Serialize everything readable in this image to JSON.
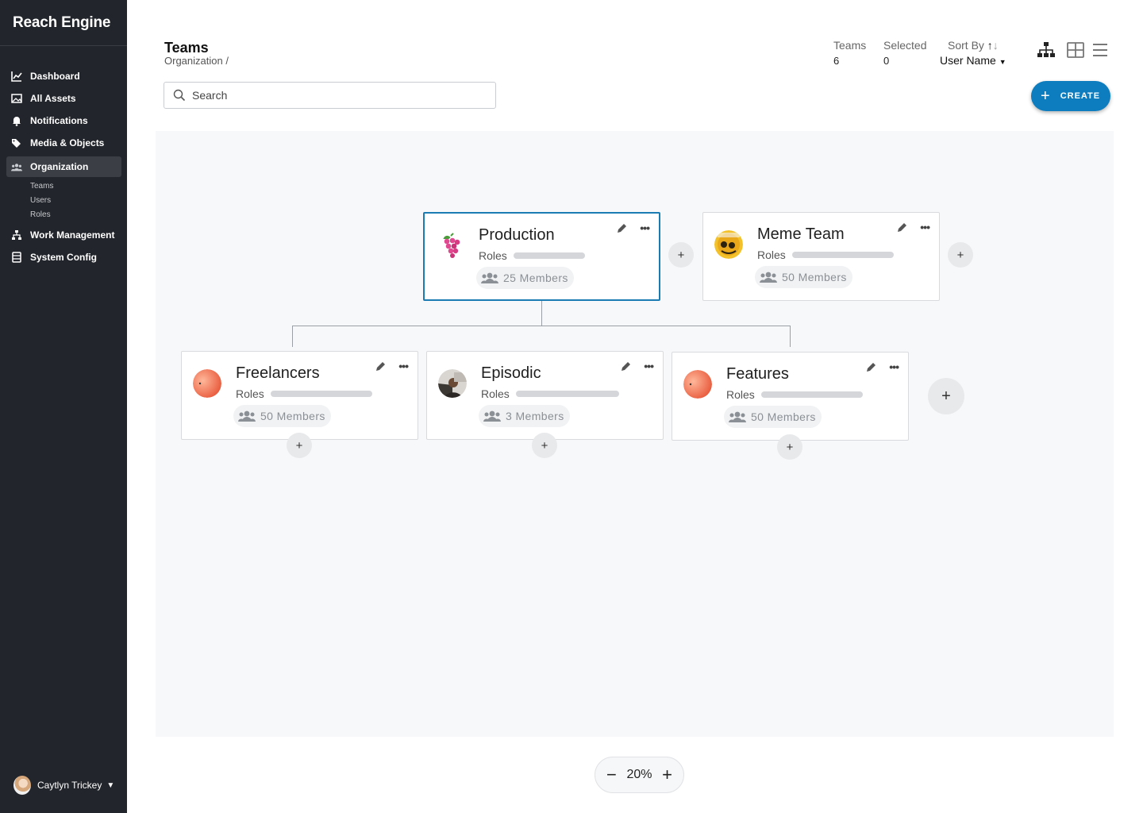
{
  "app": {
    "brand": "Reach Engine"
  },
  "sidebar": {
    "items": [
      {
        "label": "Dashboard",
        "icon": "chart-line-icon"
      },
      {
        "label": "All Assets",
        "icon": "image-icon"
      },
      {
        "label": "Notifications",
        "icon": "bell-icon"
      },
      {
        "label": "Media & Objects",
        "icon": "tags-icon"
      },
      {
        "label": "Organization",
        "icon": "users-icon",
        "active": true
      },
      {
        "label": "Work Management",
        "icon": "sitemap-icon"
      },
      {
        "label": "System Config",
        "icon": "config-icon"
      }
    ],
    "subitems": [
      "Teams",
      "Users",
      "Roles"
    ],
    "user": {
      "name": "Caytlyn Trickey"
    }
  },
  "header": {
    "title": "Teams",
    "breadcrumb": "Organization /",
    "stats": {
      "teams_label": "Teams",
      "teams_value": "6",
      "selected_label": "Selected",
      "selected_value": "0"
    },
    "sort": {
      "label": "Sort By",
      "value": "User Name"
    }
  },
  "search": {
    "placeholder": "Search"
  },
  "create": {
    "label": "CREATE"
  },
  "cards": [
    {
      "name": "Production",
      "roles_label": "Roles",
      "members": "25 Members",
      "selected": true
    },
    {
      "name": "Meme Team",
      "roles_label": "Roles",
      "members": "50 Members"
    },
    {
      "name": "Freelancers",
      "roles_label": "Roles",
      "members": "50 Members"
    },
    {
      "name": "Episodic",
      "roles_label": "Roles",
      "members": "3 Members"
    },
    {
      "name": "Features",
      "roles_label": "Roles",
      "members": "50 Members"
    }
  ],
  "add_symbol": "+",
  "zoom": {
    "value": "20%",
    "minus": "−",
    "plus": "+"
  },
  "colors": {
    "sidebar": "#22252b",
    "accent": "#0d7dbf",
    "canvas": "#f7f8f9",
    "selected_border": "#1b7bb3"
  }
}
